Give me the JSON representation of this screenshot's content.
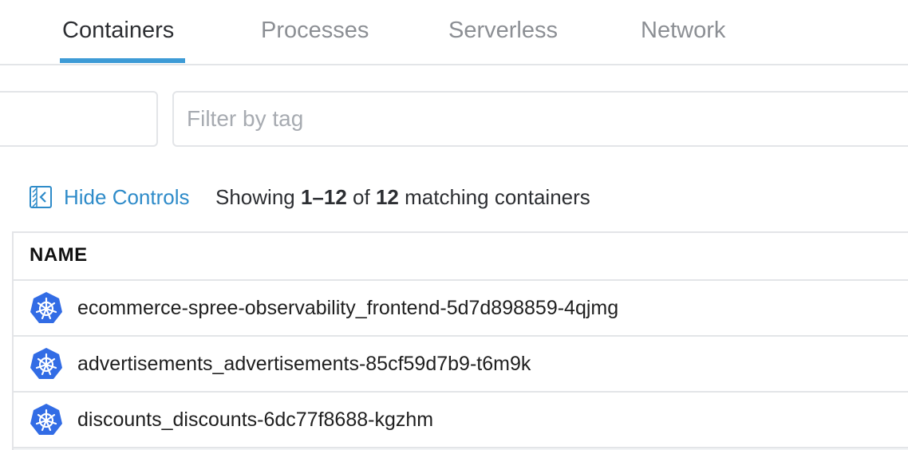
{
  "tabs": [
    {
      "label": "Containers",
      "active": true
    },
    {
      "label": "Processes",
      "active": false
    },
    {
      "label": "Serverless",
      "active": false
    },
    {
      "label": "Network",
      "active": false
    }
  ],
  "filter": {
    "tag_placeholder": "Filter by tag"
  },
  "controls": {
    "hide_label": "Hide Controls",
    "showing_prefix": "Showing ",
    "range": "1–12",
    "of_text": " of ",
    "total": "12",
    "suffix": " matching containers"
  },
  "table": {
    "header": "NAME",
    "rows": [
      {
        "name": "ecommerce-spree-observability_frontend-5d7d898859-4qjmg",
        "icon": "kubernetes-icon"
      },
      {
        "name": "advertisements_advertisements-85cf59d7b9-t6m9k",
        "icon": "kubernetes-icon"
      },
      {
        "name": "discounts_discounts-6dc77f8688-kgzhm",
        "icon": "kubernetes-icon"
      }
    ]
  },
  "colors": {
    "accent": "#3d9bd6",
    "link": "#2e8bc9",
    "kubernetes": "#326ce5"
  }
}
